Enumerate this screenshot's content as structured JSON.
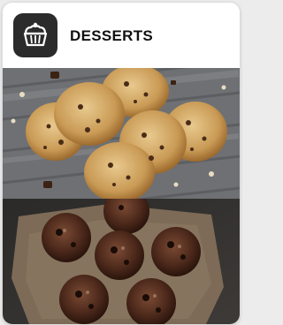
{
  "card": {
    "title": "DESSERTS",
    "icon": "cupcake-icon",
    "icon_background": "#2b2b2b"
  },
  "photos": [
    {
      "name": "cookies-photo"
    },
    {
      "name": "muffins-photo"
    }
  ]
}
